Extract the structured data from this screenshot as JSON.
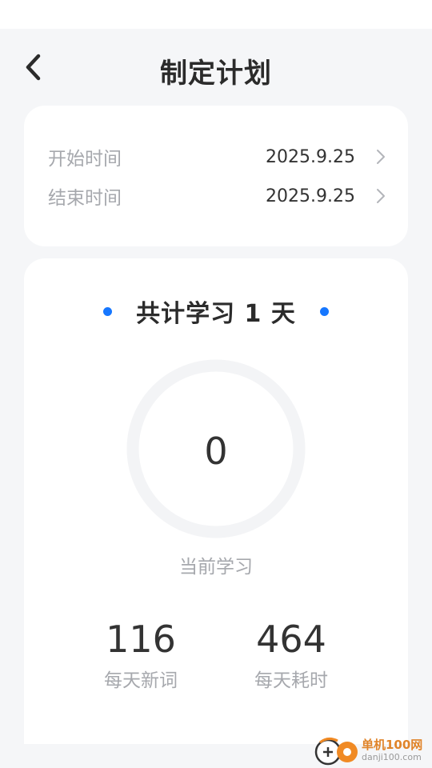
{
  "header": {
    "title": "制定计划",
    "back_icon": "chevron-left-icon"
  },
  "dates": {
    "start_label": "开始时间",
    "start_value": "2025.9.25",
    "end_label": "结束时间",
    "end_value": "2025.9.25",
    "row_icon": "chevron-right-icon"
  },
  "plan": {
    "heading": "共计学习 1 天",
    "current_value": "0",
    "current_label": "当前学习",
    "daily_words_value": "116",
    "daily_words_label": "每天新词",
    "daily_time_value": "464",
    "daily_time_label": "每天耗时"
  },
  "watermark": {
    "name": "单机100网",
    "url": "danji100.com"
  },
  "colors": {
    "accent": "#1677ff",
    "background": "#f5f6f8",
    "card": "#ffffff",
    "muted_text": "#a6a8ad",
    "ring": "#f3f4f6"
  }
}
